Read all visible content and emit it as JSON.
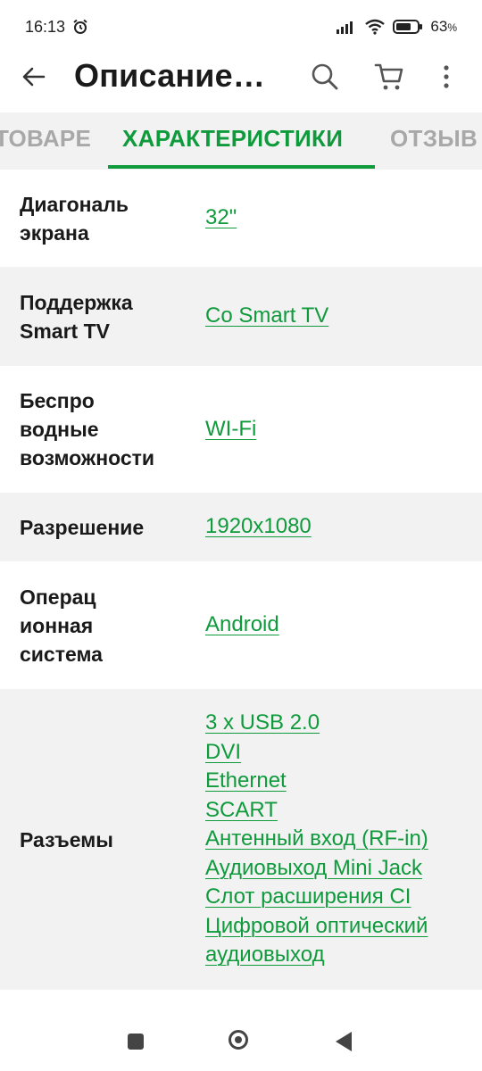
{
  "status_bar": {
    "time": "16:13",
    "battery_percent": "63"
  },
  "app_bar": {
    "title": "Описание…"
  },
  "tabs": [
    {
      "label": "ТОВАРЕ"
    },
    {
      "label": "ХАРАКТЕРИСТИКИ"
    },
    {
      "label": "ОТЗЫВ"
    }
  ],
  "specs": [
    {
      "label_lines": [
        "Диагональ",
        "экрана"
      ],
      "values": [
        "32\""
      ]
    },
    {
      "label_lines": [
        "Поддержка",
        "Smart TV"
      ],
      "values": [
        "Со Smart TV"
      ]
    },
    {
      "label_lines": [
        "Беспро",
        "водные",
        "возможности"
      ],
      "values": [
        "WI-Fi"
      ]
    },
    {
      "label_lines": [
        "Разрешение"
      ],
      "values": [
        "1920x1080"
      ]
    },
    {
      "label_lines": [
        "Операц",
        "ионная",
        "система"
      ],
      "values": [
        "Android"
      ]
    },
    {
      "label_lines": [
        "Разъемы"
      ],
      "values": [
        "3 x USB 2.0",
        "DVI",
        "Ethernet",
        "SCART",
        "Антенный вход (RF-in)",
        "Аудиовыход Mini Jack",
        "Слот расширения CI",
        "Цифровой оптический",
        "аудиовыход"
      ]
    }
  ],
  "colors": {
    "accent": "#0f9a3c",
    "tab_inactive": "#a8a8a8",
    "row_shade": "#f2f2f2"
  },
  "icons": [
    "back-arrow-icon",
    "search-icon",
    "cart-icon",
    "more-vert-icon",
    "alarm-icon",
    "signal-icon",
    "wifi-icon",
    "battery-icon"
  ]
}
